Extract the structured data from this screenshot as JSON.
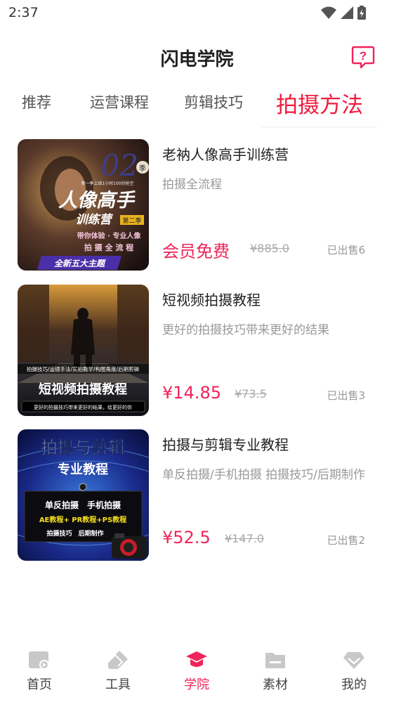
{
  "status_bar": {
    "time": "2:37"
  },
  "header": {
    "title": "闪电学院"
  },
  "tabs": [
    {
      "label": "推荐",
      "active": false
    },
    {
      "label": "运营课程",
      "active": false
    },
    {
      "label": "剪辑技巧",
      "active": false
    },
    {
      "label": "拍摄方法",
      "active": true
    }
  ],
  "courses": [
    {
      "title": "老衲人像高手训练营",
      "subtitle": "拍摄全流程",
      "price": "会员免费",
      "old_price": "¥885.0",
      "sold": "已出售6",
      "thumb": {
        "big": "02",
        "season": "季",
        "tag": "第一季上线1小时100份抢空",
        "line1": "人像高手",
        "line2": "训练营",
        "badge": "第二季",
        "line3": "带你体验 · 专业人像",
        "line4": "拍 摄 全 流 程",
        "banner": "全新五大主题"
      }
    },
    {
      "title": "短视频拍摄教程",
      "subtitle": "更好的拍摄技巧带来更好的结果",
      "price": "¥14.85",
      "old_price": "¥73.5",
      "sold": "已出售3",
      "thumb": {
        "tags": "拍摄技巧/运镜手法/实拍教学/构图角度/后期剪辑",
        "main": "短视频拍摄教程",
        "footer": "更好的拍摄技巧带来更好的结果，给更好的你"
      }
    },
    {
      "title": "拍摄与剪辑专业教程",
      "subtitle": "单反拍摄/手机拍摄 拍摄技巧/后期制作",
      "price": "¥52.5",
      "old_price": "¥147.0",
      "sold": "已出售2",
      "thumb": {
        "line1": "拍摄与剪辑",
        "line2": "专业教程",
        "row1": "单反拍摄　手机拍摄",
        "row2": "AE教程+ PR教程+PS教程",
        "row3": "拍摄技巧　后期制作"
      }
    }
  ],
  "bottom_nav": [
    {
      "label": "首页",
      "icon": "home-icon",
      "active": false
    },
    {
      "label": "工具",
      "icon": "eraser-icon",
      "active": false
    },
    {
      "label": "学院",
      "icon": "graduation-cap-icon",
      "active": true
    },
    {
      "label": "素材",
      "icon": "folder-icon",
      "active": false
    },
    {
      "label": "我的",
      "icon": "diamond-icon",
      "active": false
    }
  ],
  "colors": {
    "accent": "#f0245a",
    "tab_active": "#f01c3c",
    "muted": "#999999"
  }
}
